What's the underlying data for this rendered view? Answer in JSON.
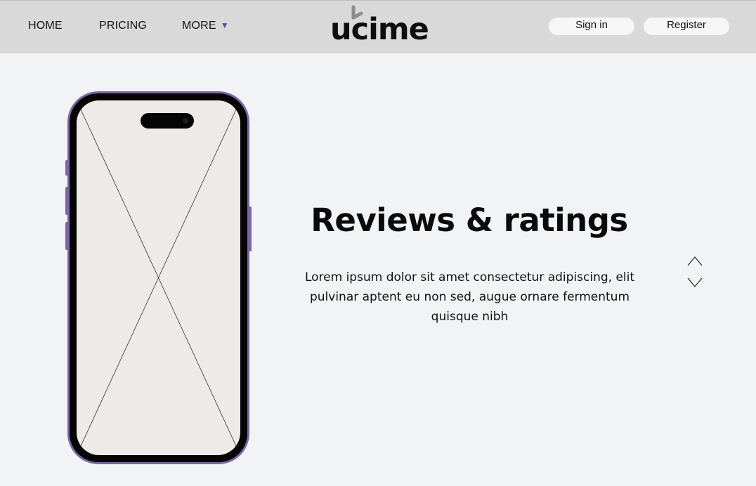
{
  "nav": {
    "links": [
      {
        "label": "HOME"
      },
      {
        "label": "PRICING"
      },
      {
        "label": "MORE"
      }
    ],
    "more_caret": "▼",
    "logo_text": "ucime",
    "signin_label": "Sign in",
    "register_label": "Register"
  },
  "hero": {
    "title": "Reviews & ratings",
    "description": "Lorem ipsum dolor sit amet consectetur adipiscing, elit pulvinar aptent eu non sed, augue ornare fermentum quisque nibh"
  },
  "colors": {
    "accent": "#5b4a9e",
    "phone_frame": "#7a66a6",
    "topbar_bg": "#d9d9d9",
    "page_bg": "#f2f3f5"
  },
  "icons": {
    "up": "chevron-up-icon",
    "down": "chevron-down-icon",
    "more_caret": "caret-down-icon"
  }
}
